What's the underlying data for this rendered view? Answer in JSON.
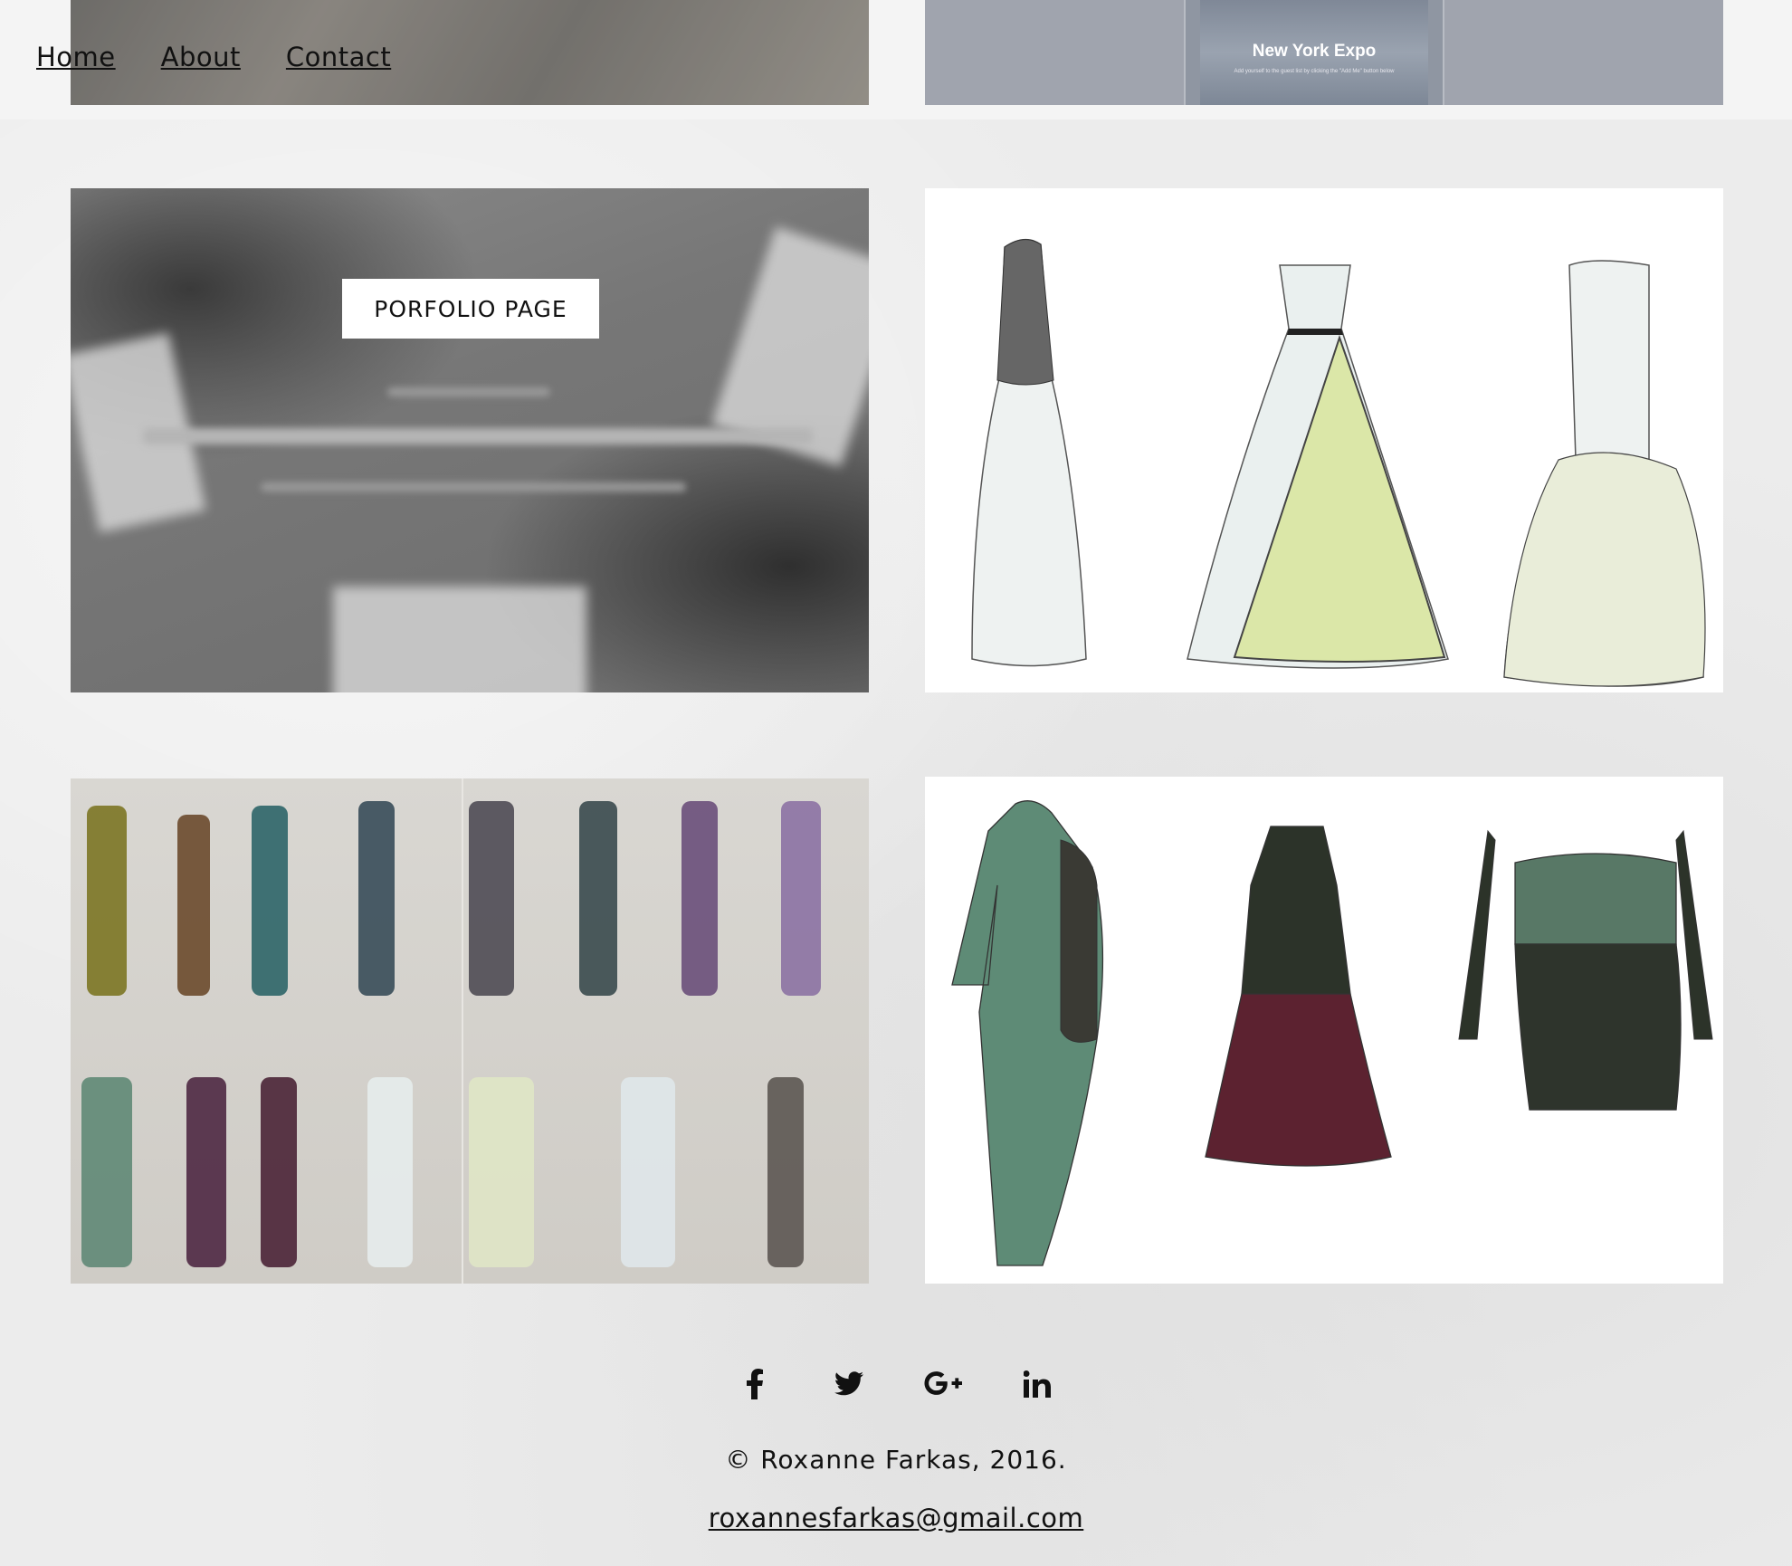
{
  "nav": {
    "home": "Home",
    "about": "About",
    "contact": "Contact"
  },
  "expo": {
    "title": "New York Expo",
    "subtitle": "Add yourself to the guest list by clicking the \"Add Me\" button below"
  },
  "portfolio": {
    "button_label": "PORFOLIO PAGE"
  },
  "social": {
    "icons": [
      "facebook-icon",
      "twitter-icon",
      "google-plus-icon",
      "linkedin-icon"
    ]
  },
  "footer": {
    "copyright": "© Roxanne Farkas, 2016.",
    "email": "roxannesfarkas@gmail.com"
  }
}
